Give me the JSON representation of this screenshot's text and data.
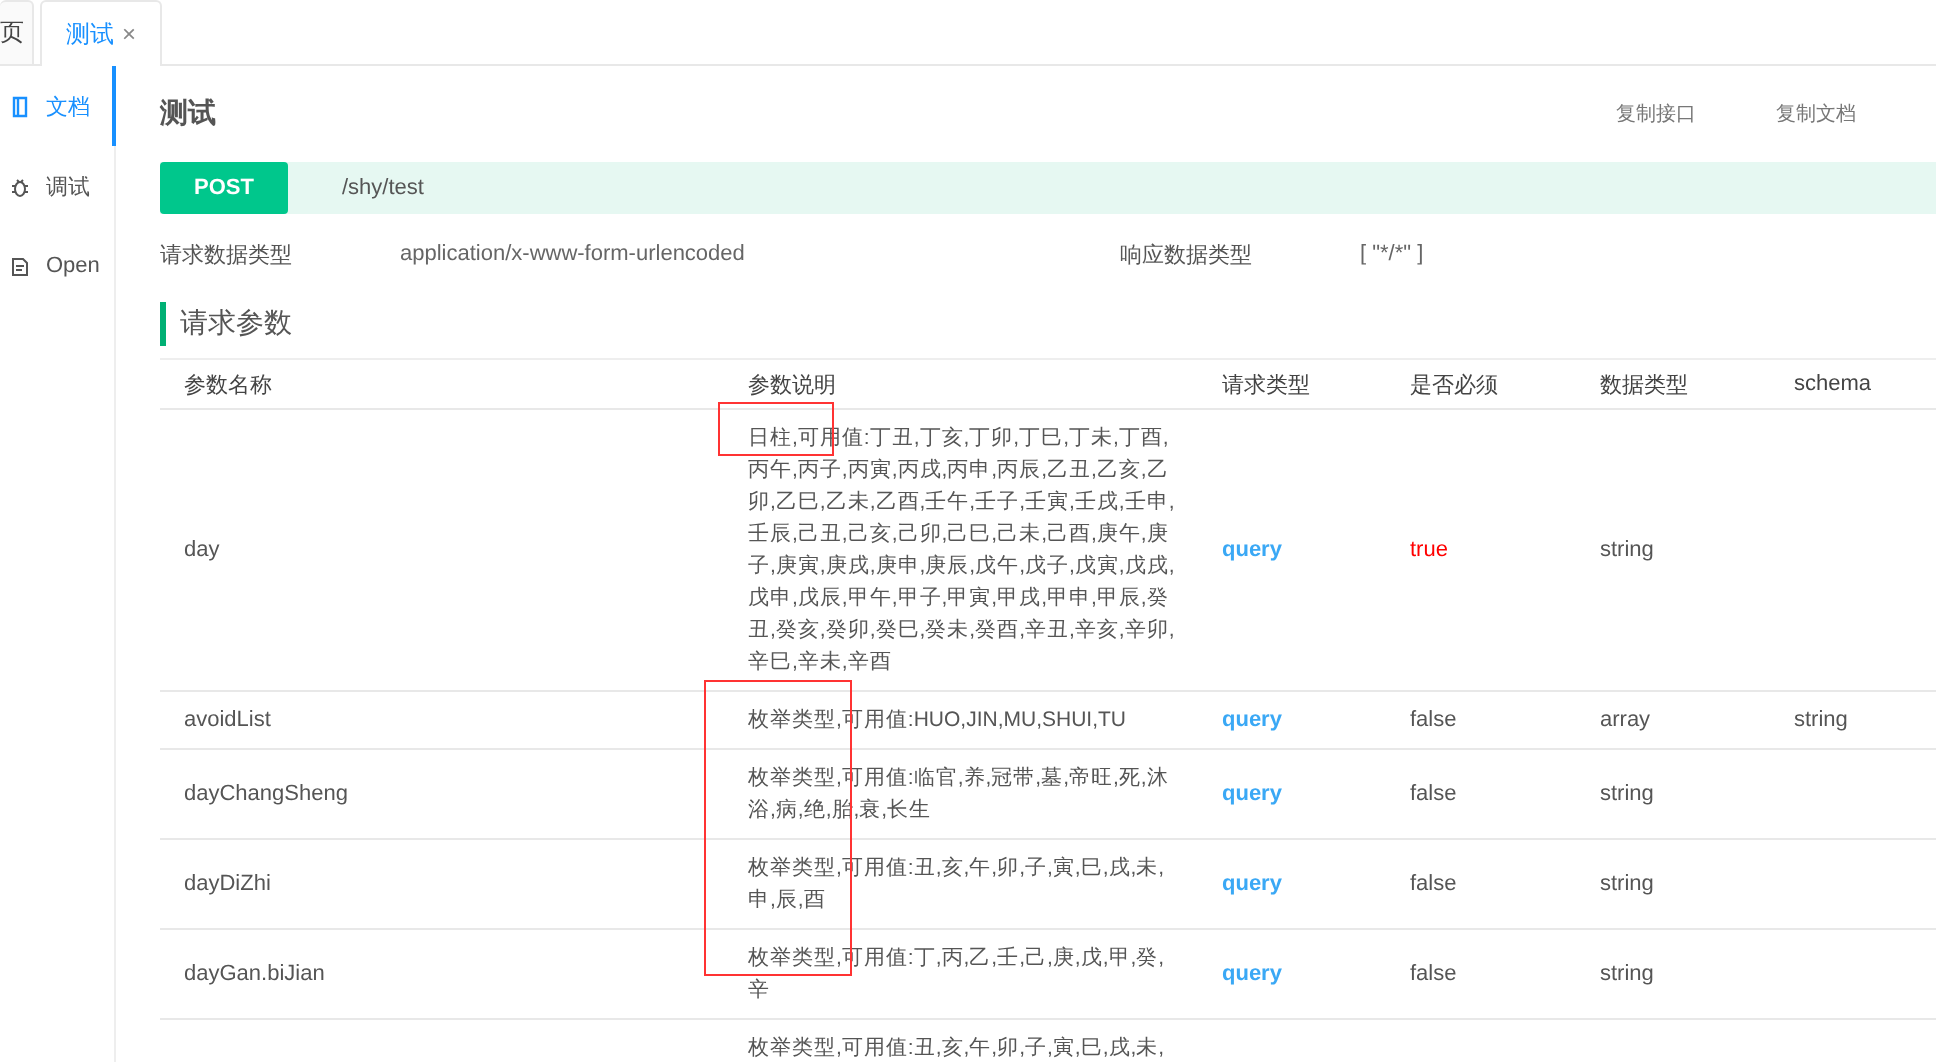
{
  "tabs": [
    {
      "label": "页",
      "selected": false
    },
    {
      "label": "测试",
      "close_glyph": "×",
      "selected": true
    }
  ],
  "sidebar": {
    "items": [
      {
        "label": "文档",
        "kind": "doc",
        "selected": true
      },
      {
        "label": "调试",
        "kind": "debug",
        "selected": false
      },
      {
        "label": "Open",
        "kind": "open",
        "selected": false
      }
    ]
  },
  "title": "测试",
  "actions": [
    "复制接口",
    "复制文档"
  ],
  "endpoint": {
    "method": "POST",
    "path": "/shy/test"
  },
  "meta": [
    {
      "label": "请求数据类型",
      "value": "application/x-www-form-urlencoded"
    },
    {
      "label": "响应数据类型",
      "value": "[ \"*/*\" ]"
    }
  ],
  "section_title": "请求参数",
  "table": {
    "columns": [
      "参数名称",
      "参数说明",
      "请求类型",
      "是否必须",
      "数据类型",
      "schema"
    ],
    "rows": [
      {
        "name": "day",
        "description": "日柱,可用值:丁丑,丁亥,丁卯,丁巳,丁未,丁酉,丙午,丙子,丙寅,丙戌,丙申,丙辰,乙丑,乙亥,乙卯,乙巳,乙未,乙酉,壬午,壬子,壬寅,壬戌,壬申,壬辰,己丑,己亥,己卯,己巳,己未,己酉,庚午,庚子,庚寅,庚戌,庚申,庚辰,戊午,戊子,戊寅,戊戌,戊申,戊辰,甲午,甲子,甲寅,甲戌,甲申,甲辰,癸丑,癸亥,癸卯,癸巳,癸未,癸酉,辛丑,辛亥,辛卯,辛巳,辛未,辛酉",
        "in": "query",
        "required": "true",
        "type": "string"
      },
      {
        "name": "avoidList",
        "description": "枚举类型,可用值:HUO,JIN,MU,SHUI,TU",
        "in": "query",
        "required": "false",
        "type": "array",
        "schema": "string"
      },
      {
        "name": "dayChangSheng",
        "description": "枚举类型,可用值:临官,养,冠带,墓,帝旺,死,沐浴,病,绝,胎,衰,长生",
        "in": "query",
        "required": "false",
        "type": "string"
      },
      {
        "name": "dayDiZhi",
        "description": "枚举类型,可用值:丑,亥,午,卯,子,寅,巳,戌,未,申,辰,酉",
        "in": "query",
        "required": "false",
        "type": "string"
      },
      {
        "name": "dayGan.biJian",
        "description": "枚举类型,可用值:丁,丙,乙,壬,己,庚,戊,甲,癸,辛",
        "in": "query",
        "required": "false",
        "type": "string"
      },
      {
        "description": "枚举类型,可用值:丑,亥,午,卯,子,寅,巳,戌,未,"
      }
    ]
  }
}
